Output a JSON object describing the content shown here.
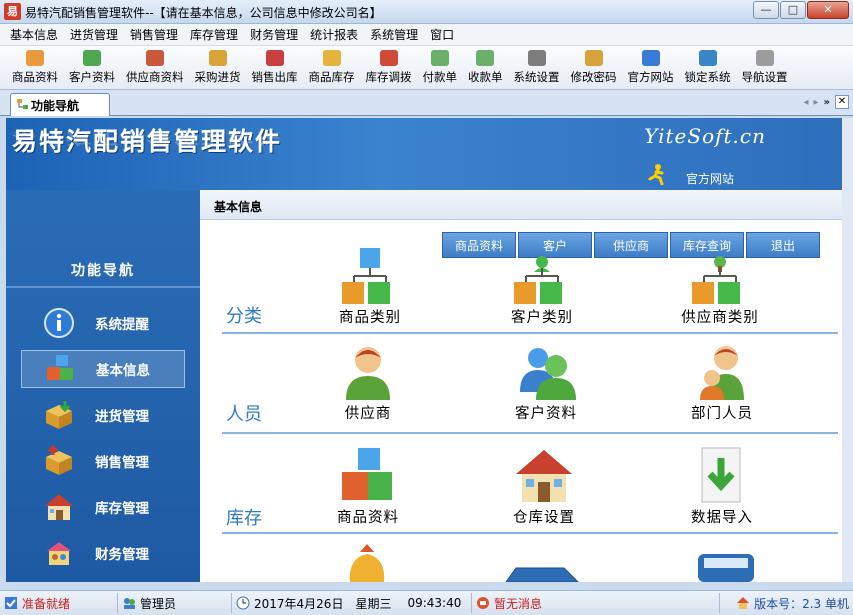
{
  "window": {
    "title": "易特汽配销售管理软件--【请在基本信息，公司信息中修改公司名】",
    "app_icon_text": "易",
    "controls": [
      "—",
      "□",
      "✕"
    ]
  },
  "menu": [
    "基本信息",
    "进货管理",
    "销售管理",
    "库存管理",
    "财务管理",
    "统计报表",
    "系统管理",
    "窗口"
  ],
  "toolbar": [
    {
      "label": "商品资料",
      "color": "#e89a3c"
    },
    {
      "label": "客户资料",
      "color": "#4fa84e"
    },
    {
      "label": "供应商资料",
      "color": "#c9583c"
    },
    {
      "label": "采购进货",
      "color": "#d9a43a"
    },
    {
      "label": "销售出库",
      "color": "#c94040"
    },
    {
      "label": "商品库存",
      "color": "#e3b33b"
    },
    {
      "label": "库存调拨",
      "color": "#d04a3a"
    },
    {
      "label": "付款单",
      "color": "#6ab06a"
    },
    {
      "label": "收款单",
      "color": "#6ab06a"
    },
    {
      "label": "系统设置",
      "color": "#7d7d7d"
    },
    {
      "label": "修改密码",
      "color": "#d8a33a"
    },
    {
      "label": "官方网站",
      "color": "#3a7ad8"
    },
    {
      "label": "锁定系统",
      "color": "#3a86c9"
    },
    {
      "label": "导航设置",
      "color": "#9c9c9c"
    }
  ],
  "tab": {
    "label": "功能导航"
  },
  "tab_ctrls": [
    "◂",
    "▸",
    "»"
  ],
  "banner": {
    "title": "易特汽配销售管理软件",
    "brand": "YiteSoft.cn",
    "site_label": "官方网站"
  },
  "sidebar": {
    "heading": "功能导航",
    "items": [
      {
        "label": "系统提醒",
        "icon": "info-icon",
        "active": false
      },
      {
        "label": "基本信息",
        "icon": "blocks-icon",
        "active": true
      },
      {
        "label": "进货管理",
        "icon": "box-in-icon",
        "active": false
      },
      {
        "label": "销售管理",
        "icon": "box-out-icon",
        "active": false
      },
      {
        "label": "库存管理",
        "icon": "house-icon",
        "active": false
      },
      {
        "label": "财务管理",
        "icon": "people-icon",
        "active": false
      }
    ]
  },
  "main": {
    "heading": "基本信息",
    "quick_buttons": [
      "商品资料",
      "客户",
      "供应商",
      "库存查询",
      "退出"
    ],
    "sections": [
      {
        "label": "分类",
        "items": [
          "商品类别",
          "客户类别",
          "供应商类别"
        ]
      },
      {
        "label": "人员",
        "items": [
          "供应商",
          "客户资料",
          "部门人员"
        ]
      },
      {
        "label": "库存",
        "items": [
          "商品资料",
          "仓库设置",
          "数据导入"
        ]
      }
    ]
  },
  "status": {
    "ready": "准备就绪",
    "user": "管理员",
    "date": "2017年4月26日",
    "weekday": "星期三",
    "time": "09:43:40",
    "messages": "暂无消息",
    "version": "版本号：2.3 单机"
  },
  "colors": {
    "accent": "#2f7bc7",
    "sidebar_bg": "#2b6cb7",
    "alert_red": "#d0201a"
  }
}
